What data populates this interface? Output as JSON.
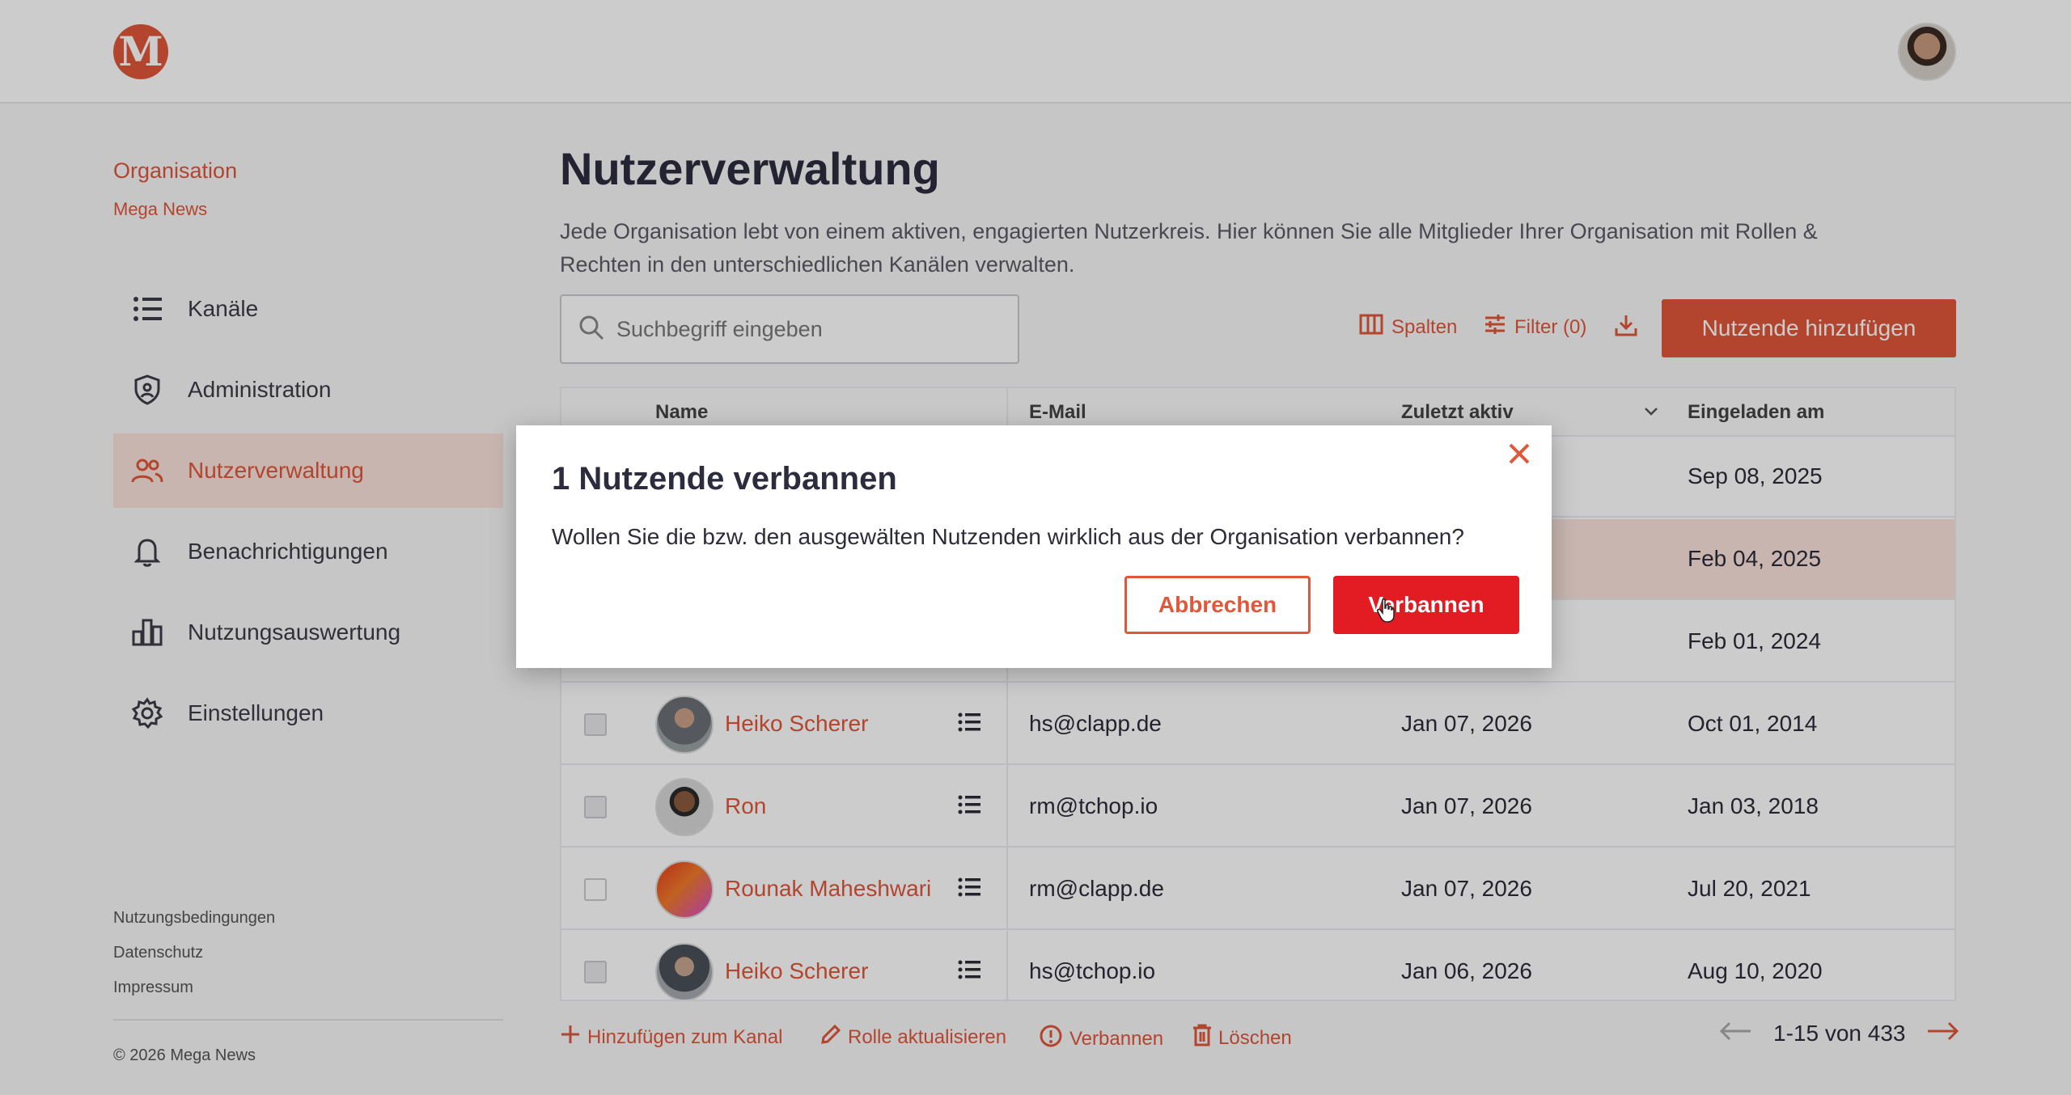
{
  "app": {
    "logo_letter": "M"
  },
  "org": {
    "label": "Organisation",
    "name": "Mega News"
  },
  "nav": {
    "items": [
      {
        "label": "Kanäle",
        "icon": "list-icon"
      },
      {
        "label": "Administration",
        "icon": "shield-icon"
      },
      {
        "label": "Nutzerverwaltung",
        "icon": "users-icon",
        "active": true
      },
      {
        "label": "Benachrichtigungen",
        "icon": "bell-icon"
      },
      {
        "label": "Nutzungsauswertung",
        "icon": "bar-chart-icon"
      },
      {
        "label": "Einstellungen",
        "icon": "gear-icon"
      }
    ]
  },
  "footer": {
    "links": [
      "Nutzungsbedingungen",
      "Datenschutz",
      "Impressum"
    ],
    "copyright": "© 2026 Mega News"
  },
  "page": {
    "title": "Nutzerverwaltung",
    "description": "Jede Organisation lebt von einem aktiven, engagierten Nutzerkreis. Hier können Sie alle Mitglieder Ihrer Organisation mit Rollen & Rechten in den unterschiedlichen Kanälen verwalten."
  },
  "search": {
    "placeholder": "Suchbegriff eingeben"
  },
  "toolbar": {
    "columns_label": "Spalten",
    "filter_label": "Filter (0)",
    "add_label": "Nutzende hinzufügen"
  },
  "table": {
    "headers": {
      "name": "Name",
      "email": "E-Mail",
      "last_active": "Zuletzt aktiv",
      "invited": "Eingeladen am"
    },
    "rows": [
      {
        "name": "",
        "email": "",
        "last_active": "",
        "invited": "Sep 08, 2025",
        "checked": false,
        "selected": false
      },
      {
        "name": "",
        "email": "",
        "last_active": "",
        "invited": "Feb 04, 2025",
        "checked": true,
        "selected": true
      },
      {
        "name": "",
        "email": "",
        "last_active": "",
        "invited": "Feb 01, 2024",
        "checked": false,
        "selected": false
      },
      {
        "name": "Heiko Scherer",
        "email": "hs@clapp.de",
        "last_active": "Jan 07, 2026",
        "invited": "Oct 01, 2014",
        "checked": true,
        "selected": false
      },
      {
        "name": "Ron",
        "email": "rm@tchop.io",
        "last_active": "Jan 07, 2026",
        "invited": "Jan 03, 2018",
        "checked": true,
        "selected": false
      },
      {
        "name": "Rounak Maheshwari",
        "email": "rm@clapp.de",
        "last_active": "Jan 07, 2026",
        "invited": "Jul 20, 2021",
        "checked": false,
        "selected": false
      },
      {
        "name": "Heiko Scherer",
        "email": "hs@tchop.io",
        "last_active": "Jan 06, 2026",
        "invited": "Aug 10, 2020",
        "checked": true,
        "selected": false
      }
    ]
  },
  "bulk": {
    "add_channel": "Hinzufügen zum Kanal",
    "update_role": "Rolle aktualisieren",
    "ban": "Verbannen",
    "delete": "Löschen"
  },
  "pager": {
    "label": "1-15 von 433"
  },
  "modal": {
    "title": "1 Nutzende verbannen",
    "text": "Wollen Sie die bzw. den ausgewälten Nutzenden wirklich aus der Organisation verbannen?",
    "cancel": "Abbrechen",
    "confirm": "Verbannen"
  },
  "colors": {
    "accent": "#e0573a",
    "danger": "#e31b23",
    "selected_row": "#fbe3dc"
  }
}
